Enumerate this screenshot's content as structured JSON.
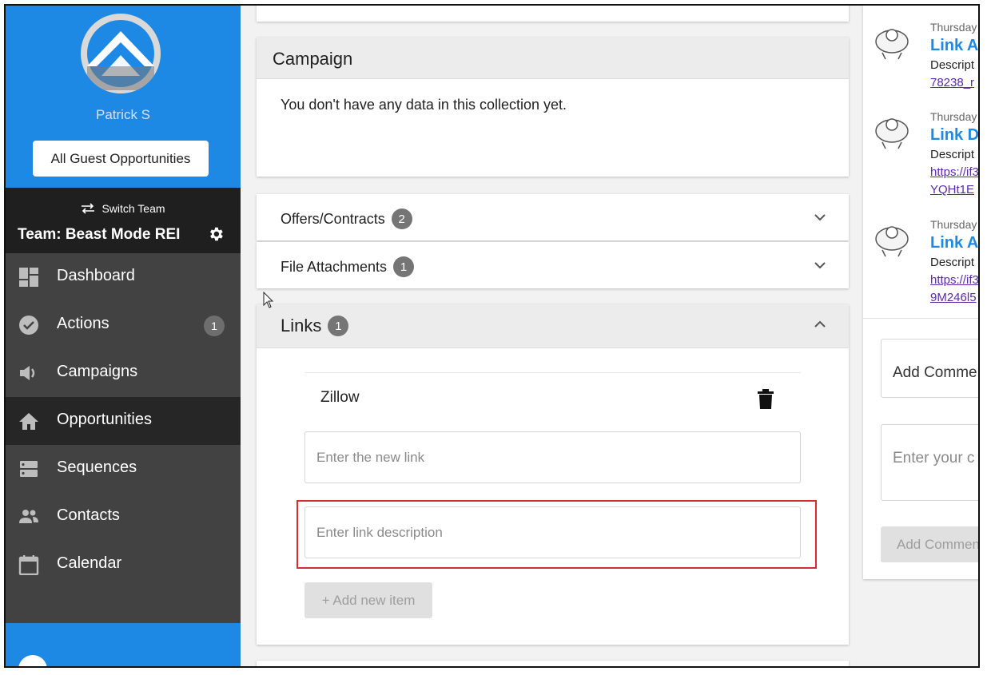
{
  "sidebar": {
    "profile_name": "Patrick S",
    "guest_button_label": "All Guest Opportunities",
    "switch_team_label": "Switch Team",
    "team_name": "Team: Beast Mode REI",
    "nav_items": [
      {
        "label": "Dashboard",
        "icon": "dashboard-icon"
      },
      {
        "label": "Actions",
        "icon": "check-circle-icon",
        "badge": "1"
      },
      {
        "label": "Campaigns",
        "icon": "megaphone-icon"
      },
      {
        "label": "Opportunities",
        "icon": "home-icon",
        "active": true
      },
      {
        "label": "Sequences",
        "icon": "sequences-icon"
      },
      {
        "label": "Contacts",
        "icon": "people-icon"
      },
      {
        "label": "Calendar",
        "icon": "calendar-icon"
      }
    ]
  },
  "main": {
    "campaign": {
      "title": "Campaign",
      "empty_text": "You don't have any data in this collection yet."
    },
    "offers": {
      "title": "Offers/Contracts",
      "count": "2"
    },
    "files": {
      "title": "File Attachments",
      "count": "1"
    },
    "links": {
      "title": "Links",
      "count": "1",
      "items": [
        {
          "label": "Zillow"
        }
      ],
      "new_link_placeholder": "Enter the new link",
      "description_placeholder": "Enter link description",
      "add_button_label": "+ Add new item"
    }
  },
  "activity": {
    "items": [
      {
        "date": "Thursday",
        "title": "Link A",
        "desc": "Descript",
        "link1": "78238_r",
        "link2": ""
      },
      {
        "date": "Thursday",
        "title": "Link D",
        "desc": "Descript",
        "link1": "https://if3",
        "link2": "YQHt1E"
      },
      {
        "date": "Thursday",
        "title": "Link A",
        "desc": "Descript",
        "link1": "https://if3",
        "link2": "9M246l5"
      }
    ],
    "comment_subject": "Add Comme",
    "comment_placeholder": "Enter your c",
    "comment_button_label": "Add Commen"
  },
  "colors": {
    "sidebar_bg": "#424242",
    "brand_blue": "#1e88e5",
    "team_bg": "#1f1f1f",
    "active_nav_bg": "#262626",
    "highlight_red": "#d32f2f",
    "link_purple": "#5b2aa6"
  }
}
